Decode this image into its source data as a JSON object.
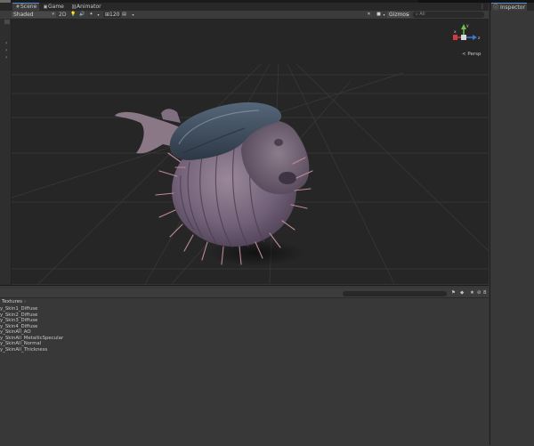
{
  "tabs": [
    {
      "label": "Scene",
      "icon": "hash-icon"
    },
    {
      "label": "Game",
      "icon": "gamepad-icon"
    },
    {
      "label": "Animator",
      "icon": "animator-icon"
    }
  ],
  "toolbar": {
    "shading": "Shaded",
    "mode_2d": "2D",
    "grid_value": "120",
    "gizmos": "Gizmos",
    "search_placeholder": "All"
  },
  "viewport": {
    "projection_label": "< Persp",
    "gizmo_axes": {
      "y": "y",
      "x": "x",
      "z": "z"
    }
  },
  "inspector": {
    "tab": "Inspector"
  },
  "project": {
    "breadcrumb": "Textures",
    "files": [
      "y_Skin1_Diffuse",
      "y_Skin2_Diffuse",
      "y_Skin3_Diffuse",
      "y_Skin4_Diffuse",
      "y_SkinAll_AO",
      "y_SkinAll_MetallicSpecular",
      "y_SkinAll_Normal",
      "y_SkinAll_Thickness"
    ],
    "badge_count": "8"
  },
  "colors": {
    "viewport_bg": "#262626",
    "panel_bg": "#383838",
    "tab_accent": "#4f8fd8",
    "fish_body": "#7c6a7e",
    "fish_cap": "#3f4e5e",
    "spines": "#c08a94"
  }
}
